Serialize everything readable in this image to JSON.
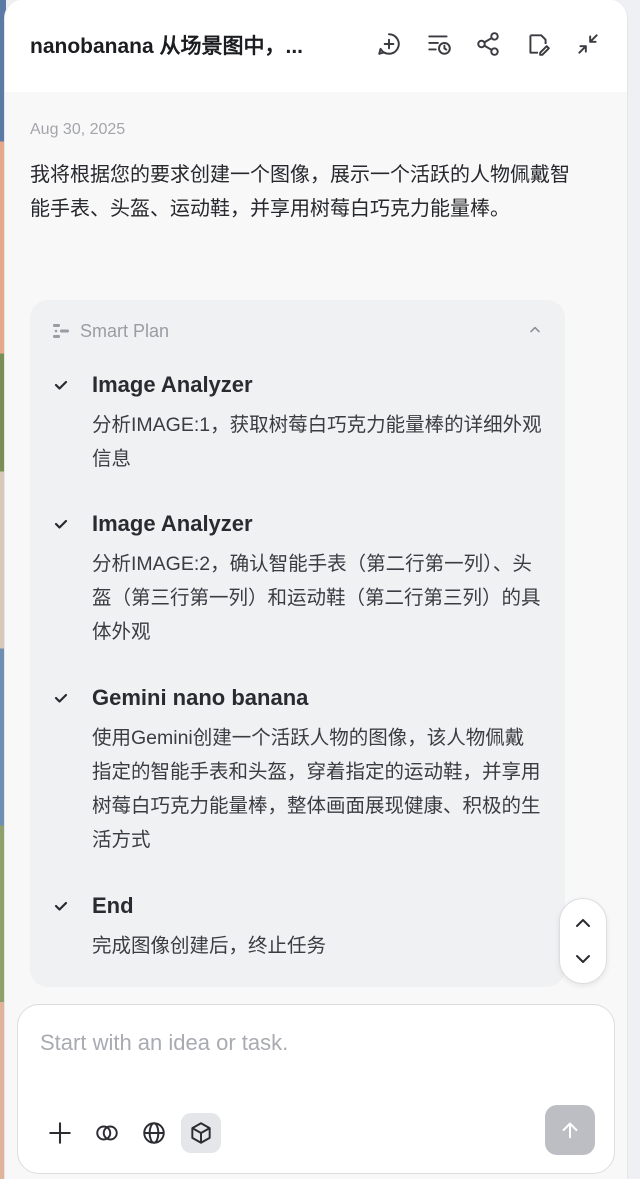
{
  "header": {
    "title": "nanobanana 从场景图中，...",
    "buttons": [
      "new-chat-icon",
      "history-icon",
      "share-icon",
      "edit-icon",
      "minimize-icon"
    ]
  },
  "conversation": {
    "date": "Aug 30, 2025",
    "message": "我将根据您的要求创建一个图像，展示一个活跃的人物佩戴智能手表、头盔、运动鞋，并享用树莓白巧克力能量棒。"
  },
  "plan": {
    "title": "Smart Plan",
    "steps": [
      {
        "title": "Image Analyzer",
        "desc": "分析IMAGE:1，获取树莓白巧克力能量棒的详细外观信息"
      },
      {
        "title": "Image Analyzer",
        "desc": "分析IMAGE:2，确认智能手表（第二行第一列）、头盔（第三行第一列）和运动鞋（第二行第三列）的具体外观"
      },
      {
        "title": "Gemini nano banana",
        "desc": "使用Gemini创建一个活跃人物的图像，该人物佩戴指定的智能手表和头盔，穿着指定的运动鞋，并享用树莓白巧克力能量棒，整体画面展现健康、积极的生活方式"
      },
      {
        "title": "End",
        "desc": "完成图像创建后，终止任务"
      }
    ]
  },
  "composer": {
    "placeholder": "Start with an idea or task.",
    "value": "",
    "tools": [
      "plus-icon",
      "link-icon",
      "globe-icon",
      "cube-icon"
    ],
    "send_icon": "arrow-up-icon"
  },
  "colors": {
    "panel_bg": "#f8f8f9",
    "plan_bg": "#f0f1f3",
    "send_disabled": "#bcbec3"
  }
}
